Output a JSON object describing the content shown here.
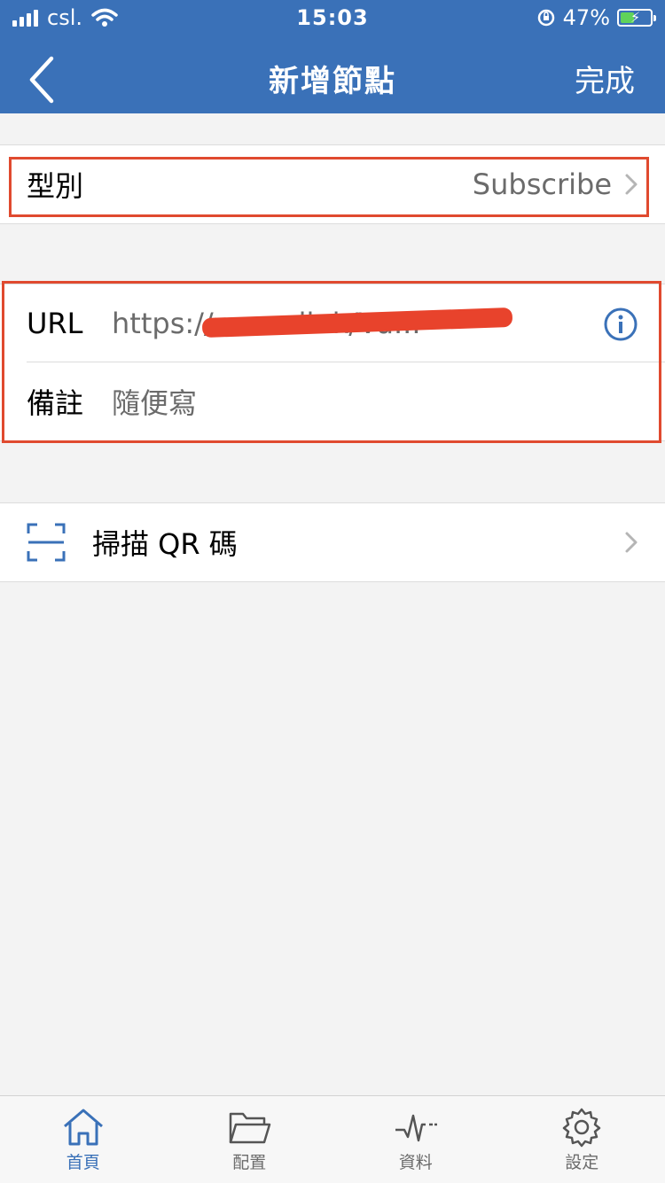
{
  "status_bar": {
    "carrier": "csl.",
    "time": "15:03",
    "battery_percent": "47%",
    "battery_level": 0.47
  },
  "nav": {
    "title": "新增節點",
    "done_label": "完成"
  },
  "type_row": {
    "label": "型別",
    "value": "Subscribe"
  },
  "url_row": {
    "label": "URL",
    "value": "https://www.                              link/Vu..."
  },
  "note_row": {
    "label": "備註",
    "value": "隨便寫"
  },
  "scan_row": {
    "label": "掃描 QR 碼"
  },
  "tabs": [
    {
      "label": "首頁",
      "icon": "home-icon",
      "active": true
    },
    {
      "label": "配置",
      "icon": "folder-icon",
      "active": false
    },
    {
      "label": "資料",
      "icon": "pulse-icon",
      "active": false
    },
    {
      "label": "設定",
      "icon": "gear-icon",
      "active": false
    }
  ],
  "colors": {
    "header": "#3a71b8",
    "accent": "#3a71b8",
    "highlight": "#e04a2f"
  }
}
